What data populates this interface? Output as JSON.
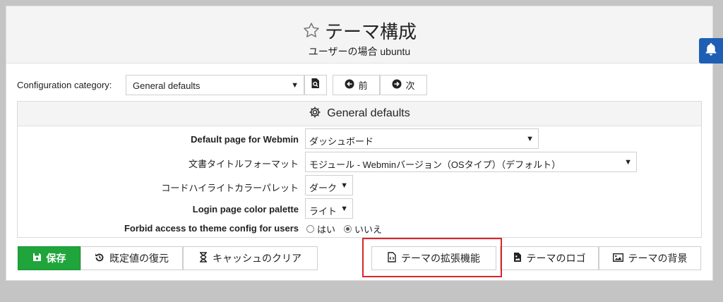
{
  "header": {
    "title": "テーマ構成",
    "subtitle": "ユーザーの場合 ubuntu"
  },
  "toolbar": {
    "category_label": "Configuration category:",
    "category_value": "General defaults",
    "prev_label": "前",
    "next_label": "次"
  },
  "settings": {
    "section_title": "General defaults",
    "rows": [
      {
        "label": "Default page for Webmin",
        "value": "ダッシュボード"
      },
      {
        "label": "文書タイトルフォーマット",
        "value": "モジュール - Webminバージョン（OSタイプ）（デフォルト）"
      },
      {
        "label": "コードハイライトカラーパレット",
        "value": "ダーク"
      },
      {
        "label": "Login page color palette",
        "value": "ライト"
      },
      {
        "label": "Forbid access to theme config for users",
        "options": [
          "はい",
          "いいえ"
        ],
        "selected": "いいえ"
      }
    ]
  },
  "buttons": {
    "save": "保存",
    "restore": "既定値の復元",
    "clear_cache": "キャッシュのクリア",
    "extensions": "テーマの拡張機能",
    "logo": "テーマのロゴ",
    "background": "テーマの背景"
  },
  "colors": {
    "save_green": "#1fa53b",
    "notification_blue": "#1e5fb5",
    "highlight_red": "#d9262b"
  },
  "icons": [
    "star-icon",
    "bell-icon",
    "search-icon",
    "arrow-left-circle-icon",
    "arrow-right-circle-icon",
    "gear-icon",
    "save-icon",
    "restore-icon",
    "hourglass-icon",
    "file-code-icon",
    "image-icon"
  ]
}
